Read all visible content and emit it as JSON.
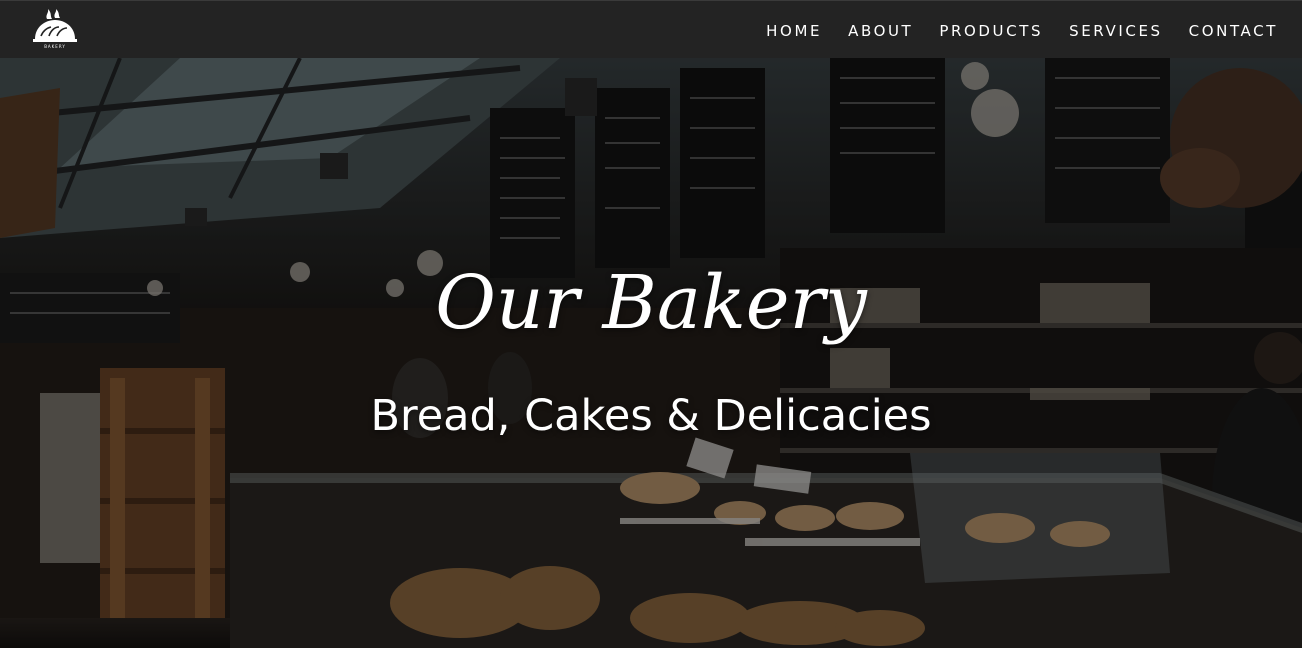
{
  "header": {
    "logo": {
      "icon": "bread-basket-icon",
      "text": "BAKERY"
    },
    "nav": [
      {
        "label": "HOME"
      },
      {
        "label": "ABOUT"
      },
      {
        "label": "PRODUCTS"
      },
      {
        "label": "SERVICES"
      },
      {
        "label": "CONTACT"
      }
    ]
  },
  "hero": {
    "title": "Our Bakery",
    "subtitle": "Bread, Cakes & Delicacies",
    "background": "bakery-interior-photo"
  },
  "colors": {
    "navbar_bg": "#232323",
    "nav_text": "#ffffff",
    "hero_text": "#ffffff"
  }
}
